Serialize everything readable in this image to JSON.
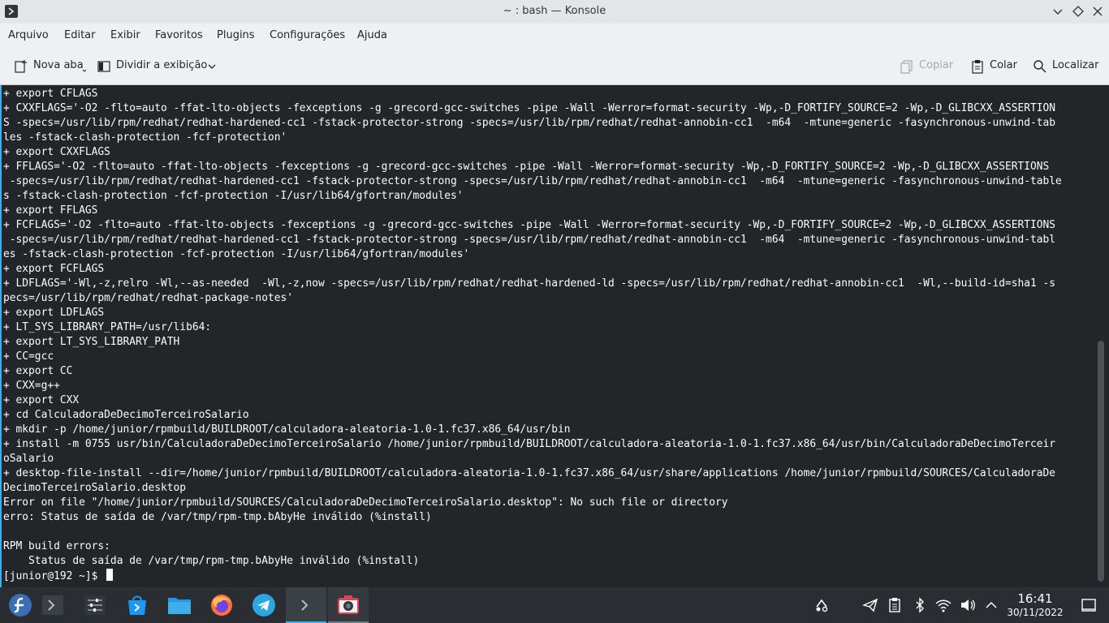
{
  "window": {
    "title": "~ : bash — Konsole"
  },
  "menubar": {
    "items": [
      "Arquivo",
      "Editar",
      "Exibir",
      "Favoritos",
      "Plugins",
      "Configurações",
      "Ajuda"
    ]
  },
  "toolbar": {
    "new_tab": "Nova aba",
    "split_view": "Dividir a exibição",
    "copy": "Copiar",
    "paste": "Colar",
    "find": "Localizar"
  },
  "terminal": {
    "lines": [
      "+ export CFLAGS",
      "+ CXXFLAGS='-O2 -flto=auto -ffat-lto-objects -fexceptions -g -grecord-gcc-switches -pipe -Wall -Werror=format-security -Wp,-D_FORTIFY_SOURCE=2 -Wp,-D_GLIBCXX_ASSERTION",
      "S -specs=/usr/lib/rpm/redhat/redhat-hardened-cc1 -fstack-protector-strong -specs=/usr/lib/rpm/redhat/redhat-annobin-cc1  -m64  -mtune=generic -fasynchronous-unwind-tab",
      "les -fstack-clash-protection -fcf-protection'",
      "+ export CXXFLAGS",
      "+ FFLAGS='-O2 -flto=auto -ffat-lto-objects -fexceptions -g -grecord-gcc-switches -pipe -Wall -Werror=format-security -Wp,-D_FORTIFY_SOURCE=2 -Wp,-D_GLIBCXX_ASSERTIONS",
      " -specs=/usr/lib/rpm/redhat/redhat-hardened-cc1 -fstack-protector-strong -specs=/usr/lib/rpm/redhat/redhat-annobin-cc1  -m64  -mtune=generic -fasynchronous-unwind-table",
      "s -fstack-clash-protection -fcf-protection -I/usr/lib64/gfortran/modules'",
      "+ export FFLAGS",
      "+ FCFLAGS='-O2 -flto=auto -ffat-lto-objects -fexceptions -g -grecord-gcc-switches -pipe -Wall -Werror=format-security -Wp,-D_FORTIFY_SOURCE=2 -Wp,-D_GLIBCXX_ASSERTIONS",
      " -specs=/usr/lib/rpm/redhat/redhat-hardened-cc1 -fstack-protector-strong -specs=/usr/lib/rpm/redhat/redhat-annobin-cc1  -m64  -mtune=generic -fasynchronous-unwind-tabl",
      "es -fstack-clash-protection -fcf-protection -I/usr/lib64/gfortran/modules'",
      "+ export FCFLAGS",
      "+ LDFLAGS='-Wl,-z,relro -Wl,--as-needed  -Wl,-z,now -specs=/usr/lib/rpm/redhat/redhat-hardened-ld -specs=/usr/lib/rpm/redhat/redhat-annobin-cc1  -Wl,--build-id=sha1 -s",
      "pecs=/usr/lib/rpm/redhat/redhat-package-notes'",
      "+ export LDFLAGS",
      "+ LT_SYS_LIBRARY_PATH=/usr/lib64:",
      "+ export LT_SYS_LIBRARY_PATH",
      "+ CC=gcc",
      "+ export CC",
      "+ CXX=g++",
      "+ export CXX",
      "+ cd CalculadoraDeDecimoTerceiroSalario",
      "+ mkdir -p /home/junior/rpmbuild/BUILDROOT/calculadora-aleatoria-1.0-1.fc37.x86_64/usr/bin",
      "+ install -m 0755 usr/bin/CalculadoraDeDecimoTerceiroSalario /home/junior/rpmbuild/BUILDROOT/calculadora-aleatoria-1.0-1.fc37.x86_64/usr/bin/CalculadoraDeDecimoTerceir",
      "oSalario",
      "+ desktop-file-install --dir=/home/junior/rpmbuild/BUILDROOT/calculadora-aleatoria-1.0-1.fc37.x86_64/usr/share/applications /home/junior/rpmbuild/SOURCES/CalculadoraDe",
      "DecimoTerceiroSalario.desktop",
      "Error on file \"/home/junior/rpmbuild/SOURCES/CalculadoraDeDecimoTerceiroSalario.desktop\": No such file or directory",
      "erro: Status de saída de /var/tmp/rpm-tmp.bAbyHe inválido (%install)",
      "",
      "RPM build errors:",
      "    Status de saída de /var/tmp/rpm-tmp.bAbyHe inválido (%install)"
    ],
    "prompt": "[junior@192 ~]$ "
  },
  "taskbar": {
    "apps": [
      "fedora-launcher-icon",
      "konsole-icon",
      "system-settings-icon",
      "discover-store-icon",
      "dolphin-files-icon",
      "firefox-icon",
      "telegram-icon",
      "konsole-active-icon",
      "spectacle-icon"
    ],
    "clock_time": "16:41",
    "clock_date": "30/11/2022"
  }
}
